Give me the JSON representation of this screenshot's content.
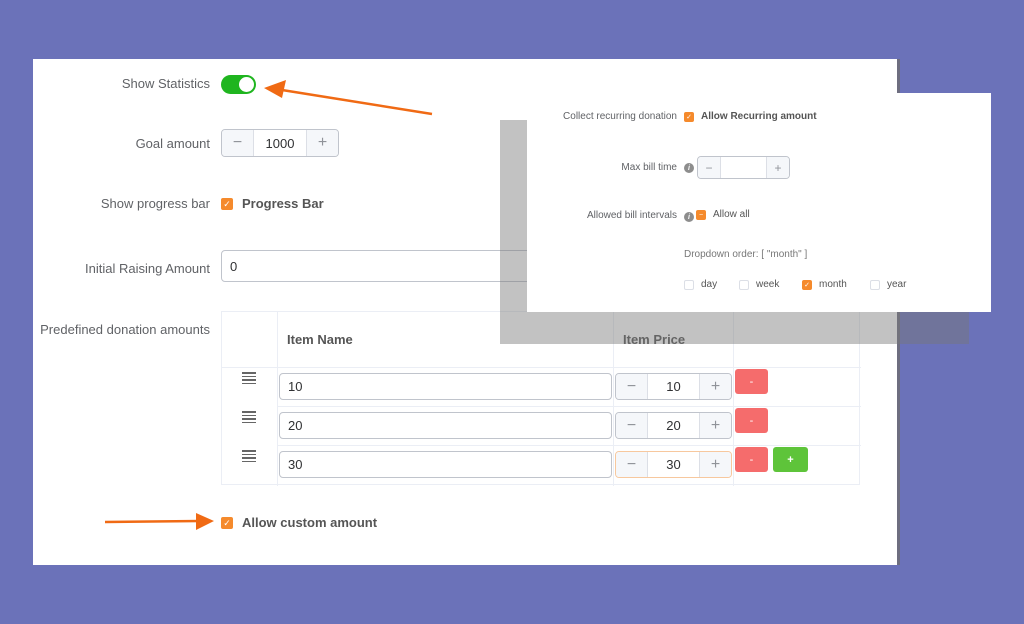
{
  "settings": {
    "show_statistics": {
      "label": "Show Statistics",
      "enabled": true
    },
    "goal_amount": {
      "label": "Goal amount",
      "value": "1000",
      "minus": "−",
      "plus": "+"
    },
    "show_progress_bar": {
      "label": "Show progress bar",
      "checkbox_label": "Progress Bar",
      "checked": true
    },
    "initial_raising_amount": {
      "label": "Initial Raising Amount",
      "value": "0"
    },
    "predefined_amounts": {
      "label": "Predefined donation amounts",
      "columns": [
        "Item Name",
        "Item Price"
      ],
      "rows": [
        {
          "name": "10",
          "price": "10",
          "delete_label": "-"
        },
        {
          "name": "20",
          "price": "20",
          "delete_label": "-"
        },
        {
          "name": "30",
          "price": "30",
          "delete_label": "-",
          "add_label": "+"
        }
      ],
      "minus": "−",
      "plus": "+"
    },
    "allow_custom_amount": {
      "label": "Allow custom amount",
      "checked": true
    }
  },
  "recurring": {
    "collect_label": "Collect recurring donation",
    "allow_recurring_label": "Allow Recurring amount",
    "max_bill_time": {
      "label": "Max bill time",
      "value": "",
      "minus": "−",
      "plus": "+"
    },
    "allowed_intervals": {
      "label": "Allowed bill intervals",
      "allow_all_label": "Allow all"
    },
    "dropdown_order": "Dropdown order: [ \"month\" ]",
    "intervals": [
      {
        "label": "day",
        "checked": false
      },
      {
        "label": "week",
        "checked": false
      },
      {
        "label": "month",
        "checked": true
      },
      {
        "label": "year",
        "checked": false
      }
    ],
    "info_glyph": "i"
  },
  "colors": {
    "background": "#6b72b9",
    "accent_orange": "#f58a2c",
    "toggle_green": "#1fb51f",
    "delete_red": "#f56c6c",
    "add_green": "#5ec43a",
    "arrow_orange": "#f06a14"
  },
  "icons": {
    "check": "✓",
    "indeterminate": "−"
  }
}
